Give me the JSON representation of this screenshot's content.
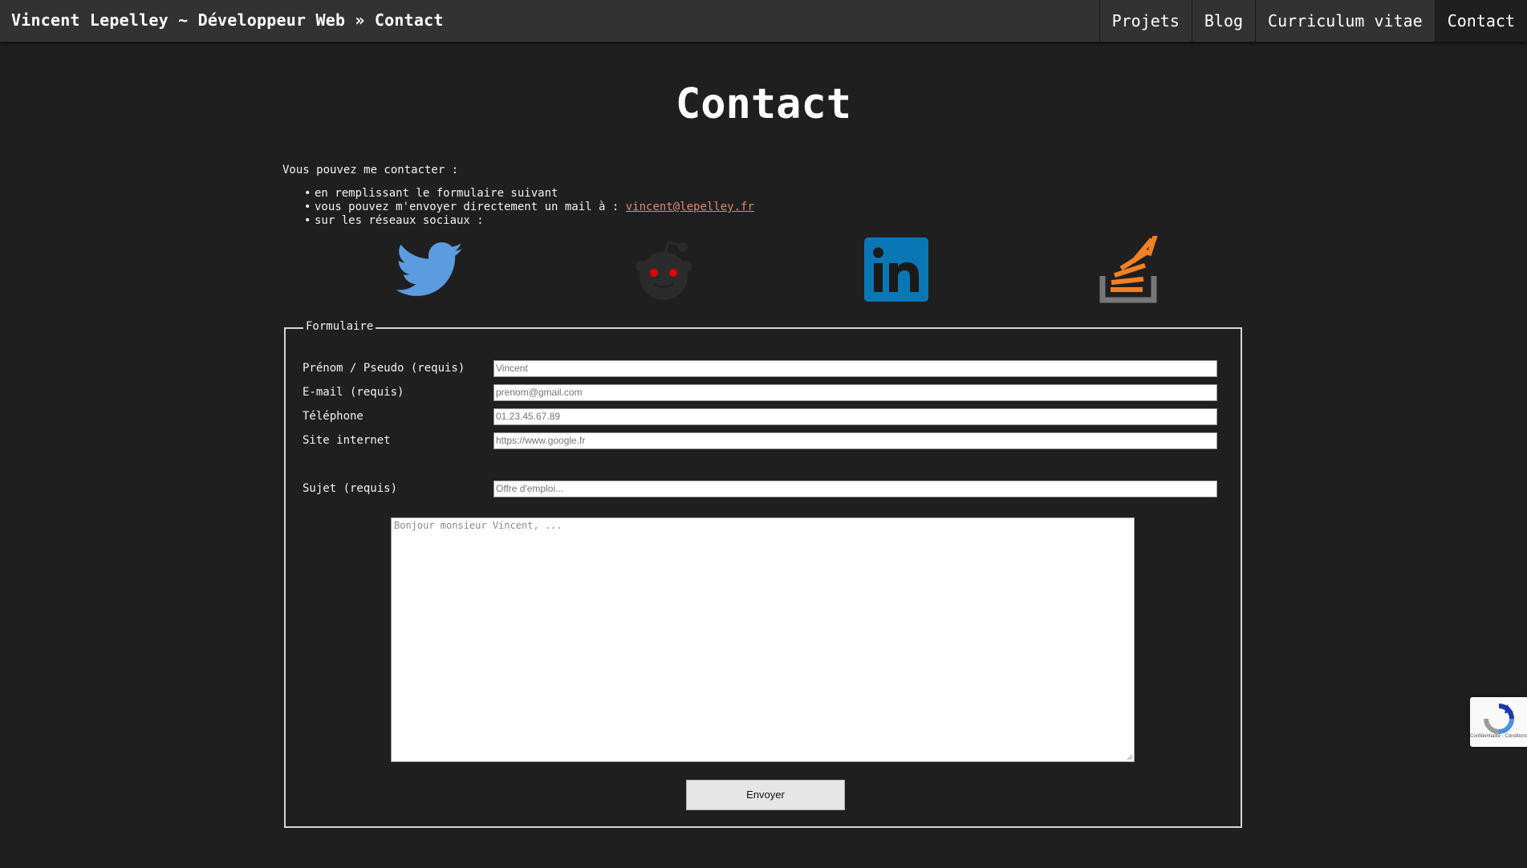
{
  "header": {
    "site_title": "Vincent Lepelley ~ Développeur Web » Contact",
    "nav": [
      {
        "label": "Projets"
      },
      {
        "label": "Blog"
      },
      {
        "label": "Curriculum vitae"
      },
      {
        "label": "Contact",
        "active": true
      }
    ]
  },
  "page": {
    "title": "Contact",
    "intro": "Vous pouvez me contacter :",
    "list": {
      "item1": "en remplissant le formulaire suivant",
      "item2_prefix": "vous pouvez m'envoyer directement un mail à : ",
      "item2_link": "vincent@lepelley.fr",
      "item3": "sur les réseaux sociaux :"
    }
  },
  "social": [
    {
      "icon": "twitter-icon",
      "color": "#5b9be0"
    },
    {
      "icon": "reddit-icon",
      "color": "#2b2b2b",
      "accent": "#e00000"
    },
    {
      "icon": "linkedin-icon",
      "color": "#0a77b5"
    },
    {
      "icon": "stackoverflow-icon",
      "color": "#f48024",
      "tray": "#777777"
    }
  ],
  "form": {
    "legend": "Formulaire",
    "fields": {
      "firstname": {
        "label": "Prénom / Pseudo (requis)",
        "placeholder": "Vincent"
      },
      "email": {
        "label": "E-mail (requis)",
        "placeholder": "prenom@gmail.com"
      },
      "phone": {
        "label": "Téléphone",
        "placeholder": "01.23.45.67.89"
      },
      "website": {
        "label": "Site internet",
        "placeholder": "https://www.google.fr"
      },
      "subject": {
        "label": "Sujet (requis)",
        "placeholder": "Offre d'emploi..."
      }
    },
    "message_placeholder": "Bonjour monsieur Vincent, ...",
    "submit_label": "Envoyer"
  },
  "recaptcha": {
    "terms": "Confidentialité - Conditions"
  }
}
